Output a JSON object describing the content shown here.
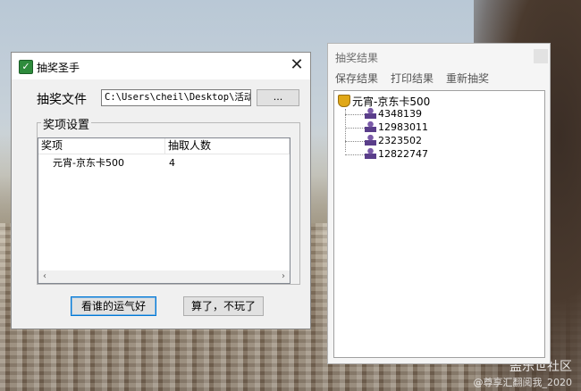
{
  "desktop": {
    "watermark": "盖乐世社区",
    "watermark_sub": "@尊享汇翻阅我_2020"
  },
  "main_window": {
    "title": "抽奖圣手",
    "file_label": "抽奖文件",
    "file_path": "C:\\Users\\cheil\\Desktop\\活动抽",
    "browse_label": "...",
    "group_label": "奖项设置",
    "columns": [
      "奖项",
      "抽取人数"
    ],
    "rows": [
      {
        "prize": "元宵-京东卡500",
        "count": "4"
      }
    ],
    "lucky_button": "看谁的运气好",
    "quit_button": "算了，不玩了"
  },
  "results_window": {
    "title": "抽奖结果",
    "menu": [
      "保存结果",
      "打印结果",
      "重新抽奖"
    ],
    "tree_root": "元宵-京东卡500",
    "winners": [
      "4348139",
      "12983011",
      "2323502",
      "12822747"
    ]
  }
}
